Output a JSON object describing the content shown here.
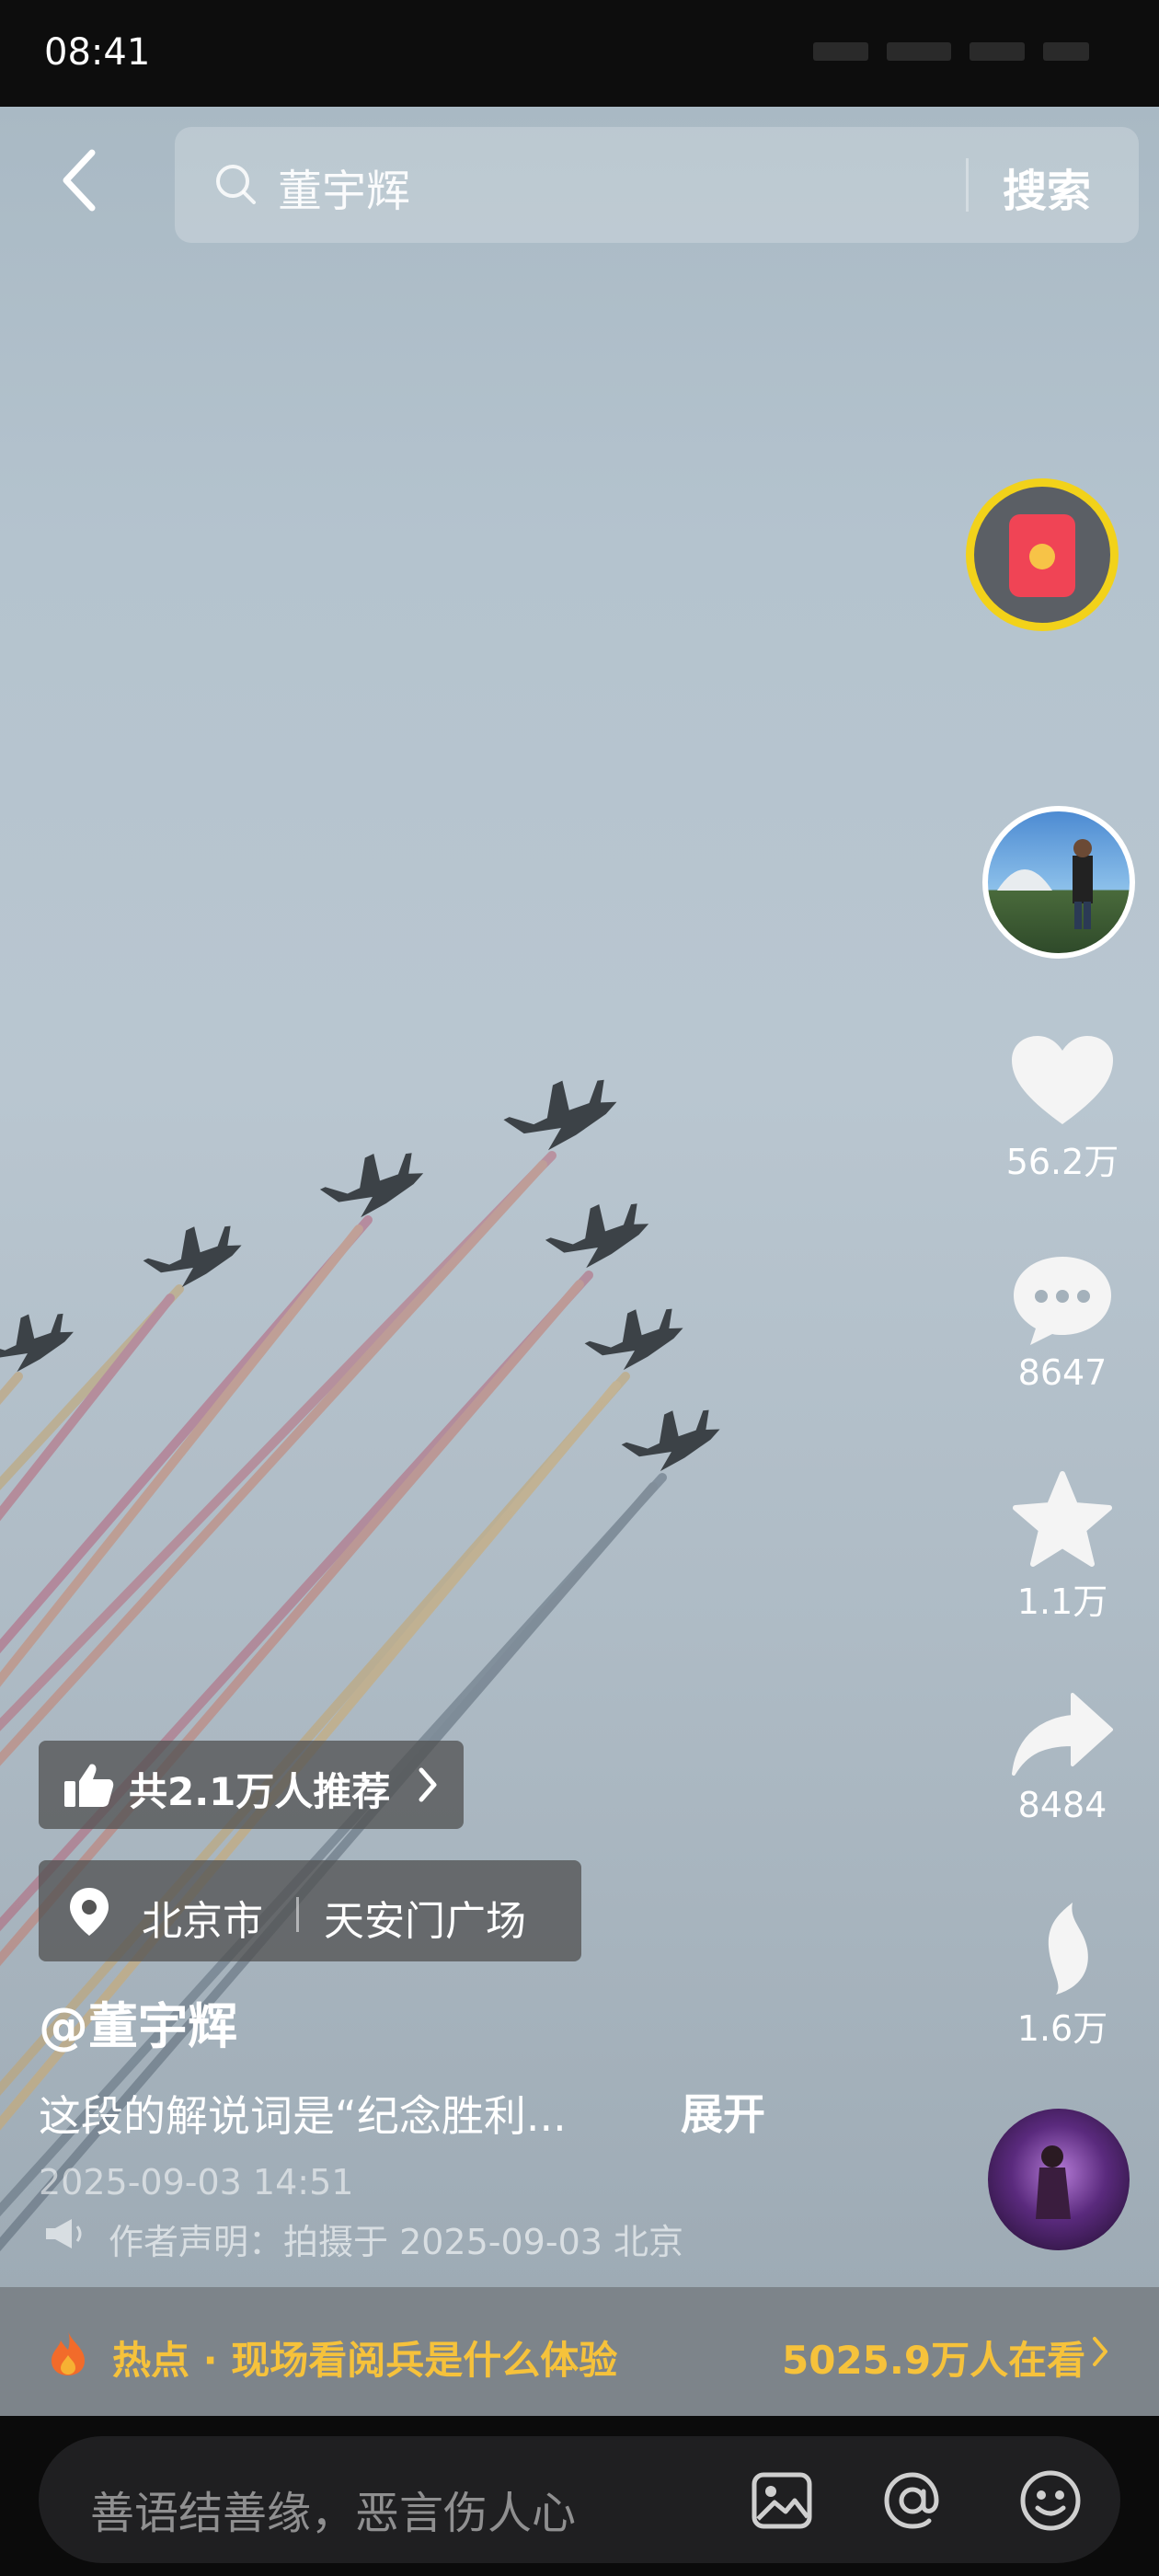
{
  "status_bar": {
    "time": "08:41"
  },
  "search": {
    "query": "董宇辉",
    "button": "搜索"
  },
  "side_actions": {
    "likes": "56.2万",
    "comments": "8647",
    "favorites": "1.1万",
    "shares": "8484",
    "remix": "1.6万"
  },
  "recommend": {
    "text": "共2.1万人推荐"
  },
  "location": {
    "city": "北京市",
    "place": "天安门广场"
  },
  "author": {
    "handle": "@董宇辉"
  },
  "caption": {
    "text": "这段的解说词是“纪念胜利...",
    "expand": "展开"
  },
  "timestamp": "2025-09-03 14:51",
  "statement": "作者声明：拍摄于 2025-09-03 北京",
  "hot": {
    "label": "热点 · 现场看阅兵是什么体验",
    "viewers": "5025.9万人在看"
  },
  "comment": {
    "placeholder": "善语结善缘，恶言伤人心"
  },
  "colors": {
    "hot_yellow": "#f6c23b",
    "redpacket_ring": "#f2d21a",
    "redpacket_red": "#f04455"
  },
  "icons": [
    "back-icon",
    "search-icon",
    "redpacket-icon",
    "heart-icon",
    "comment-icon",
    "star-icon",
    "share-icon",
    "remix-icon",
    "thumbs-up-icon",
    "location-pin-icon",
    "megaphone-icon",
    "fire-icon",
    "image-icon",
    "at-icon",
    "emoji-icon"
  ]
}
